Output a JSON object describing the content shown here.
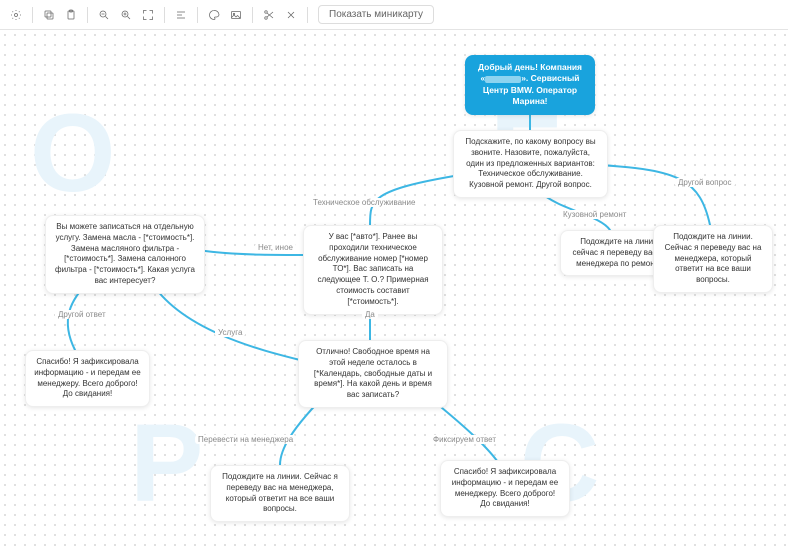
{
  "toolbar": {
    "minimap_label": "Показать миникарту"
  },
  "nodes": {
    "root_l1": "Добрый день! Компания",
    "root_l2": "«",
    "root_l3": "». Сервисный",
    "root_l4": "Центр BMW. Оператор",
    "root_l5": "Марина!",
    "ask": "Подскажите, по какому вопросу вы звоните. Назовите, пожалуйста, один из предложенных вариантов: Техническое обслуживание. Кузовной ремонт. Другой вопрос.",
    "to": "У вас [*авто*]. Ранее вы проходили техническое обслуживание номер [*номер ТО*]. Вас записать на следующее Т. О.? Примерная стоимость составит [*стоимость*].",
    "kuz": "Подождите на линии. сейчас я переведу вас на менеджера по ремонту.",
    "other": "Подождите на линии. Сейчас я переведу вас на менеджера, который ответит на все ваши вопросы.",
    "net": "Вы можете записаться на отдельную услугу. Замена масла - [*стоимость*]. Замена масляного фильтра - [*стоимость*]. Замена салонного фильтра - [*стоимость*]. Какая услуга вас интересует?",
    "da": "Отлично! Свободное время на этой неделе осталось в [*Календарь, свободные даты и время*]. На какой день и время вас записать?",
    "ans_other": "Спасибо! Я зафиксировала информацию - и передам ее менеджеру. Всего доброго! До свидания!",
    "mgr": "Подождите на линии. Сейчас я переведу вас на менеджера, который ответит на все ваши вопросы.",
    "fix": "Спасибо! Я зафиксировала информацию - и передам ее менеджеру. Всего доброго! До свидания!"
  },
  "labels": {
    "to": "Техническое обслуживание",
    "kuz": "Кузовной ремонт",
    "other": "Другой вопрос",
    "net": "Нет, иное",
    "da": "Да",
    "ans_other": "Другой ответ",
    "usluga": "Услуга",
    "mgr": "Перевести на менеджера",
    "fix": "Фиксируем ответ"
  }
}
